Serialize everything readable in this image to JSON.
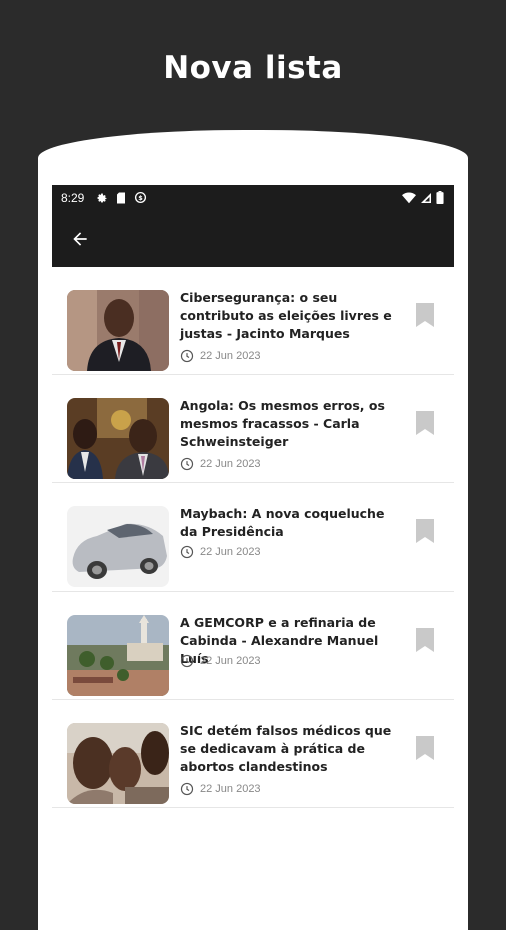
{
  "promo": {
    "title": "Nova lista"
  },
  "status_bar": {
    "time": "8:29"
  },
  "articles": [
    {
      "title": "Cibersegurança: o seu contributo as eleições livres e justas - Jacinto Marques",
      "date": "22 Jun 2023"
    },
    {
      "title": "Angola: Os mesmos erros, os mesmos fracassos - Carla Schweinsteiger",
      "date": "22 Jun 2023"
    },
    {
      "title": "Maybach: A nova coqueluche da Presidência",
      "date": "22 Jun 2023"
    },
    {
      "title": "A GEMCORP e a refinaria de Cabinda - Alexandre Manuel Luís",
      "date": "22 Jun 2023"
    },
    {
      "title": "SIC detém falsos médicos que se dedicavam à prática de abortos clandestinos",
      "date": "22 Jun 2023"
    }
  ],
  "colors": {
    "background": "#2b2b2b",
    "app_bar": "#1c1c1c",
    "bookmark": "#c9c9c9"
  }
}
